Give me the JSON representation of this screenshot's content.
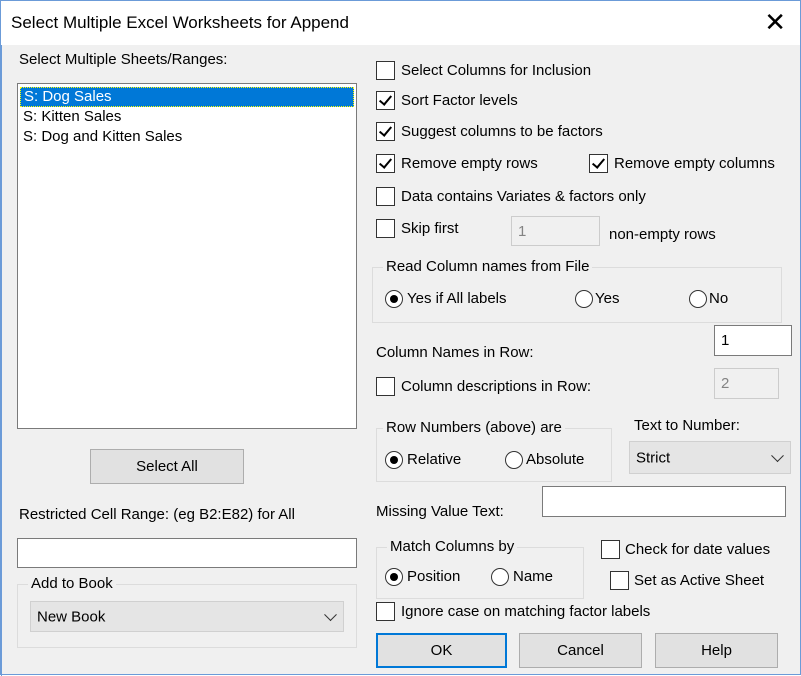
{
  "dialog": {
    "title": "Select Multiple Excel Worksheets for Append",
    "close_glyph": "✕"
  },
  "sheets": {
    "label": "Select Multiple Sheets/Ranges:",
    "items": [
      "S: Dog Sales",
      "S: Kitten Sales",
      "S: Dog and Kitten Sales"
    ],
    "selected_index": 0,
    "select_all_label": "Select All"
  },
  "range": {
    "label": "Restricted Cell Range: (eg B2:E82) for All",
    "value": ""
  },
  "add_to_book": {
    "title": "Add to Book",
    "value": "New Book"
  },
  "options": {
    "select_columns": {
      "label": "Select Columns for Inclusion",
      "checked": false
    },
    "sort_factor": {
      "label": "Sort Factor levels",
      "checked": true
    },
    "suggest_factors": {
      "label": "Suggest columns to be factors",
      "checked": true
    },
    "remove_empty_rows": {
      "label": "Remove empty rows",
      "checked": true
    },
    "remove_empty_columns": {
      "label": "Remove empty columns",
      "checked": true
    },
    "variates_only": {
      "label": "Data contains Variates & factors only",
      "checked": false
    },
    "skip_first": {
      "label": "Skip first",
      "checked": false,
      "value": "1",
      "suffix": "non-empty rows"
    }
  },
  "read_names": {
    "title": "Read Column names from File",
    "options": [
      "Yes if All labels",
      "Yes",
      "No"
    ],
    "selected": 0
  },
  "col_names_row": {
    "label": "Column Names in Row:",
    "value": "1"
  },
  "col_desc_row": {
    "label": "Column descriptions in Row:",
    "checked": false,
    "value": "2"
  },
  "row_numbers": {
    "title": "Row Numbers (above) are",
    "options": [
      "Relative",
      "Absolute"
    ],
    "selected": 0
  },
  "text_to_number": {
    "label": "Text to Number:",
    "value": "Strict"
  },
  "missing_value": {
    "label": "Missing Value Text:",
    "value": ""
  },
  "match_columns": {
    "title": "Match Columns by",
    "options": [
      "Position",
      "Name"
    ],
    "selected": 0
  },
  "check_dates": {
    "label": "Check for date values",
    "checked": false
  },
  "active_sheet": {
    "label": "Set as Active Sheet",
    "checked": false
  },
  "ignore_case": {
    "label": "Ignore case on matching factor labels",
    "checked": false
  },
  "buttons": {
    "ok": "OK",
    "cancel": "Cancel",
    "help": "Help"
  }
}
